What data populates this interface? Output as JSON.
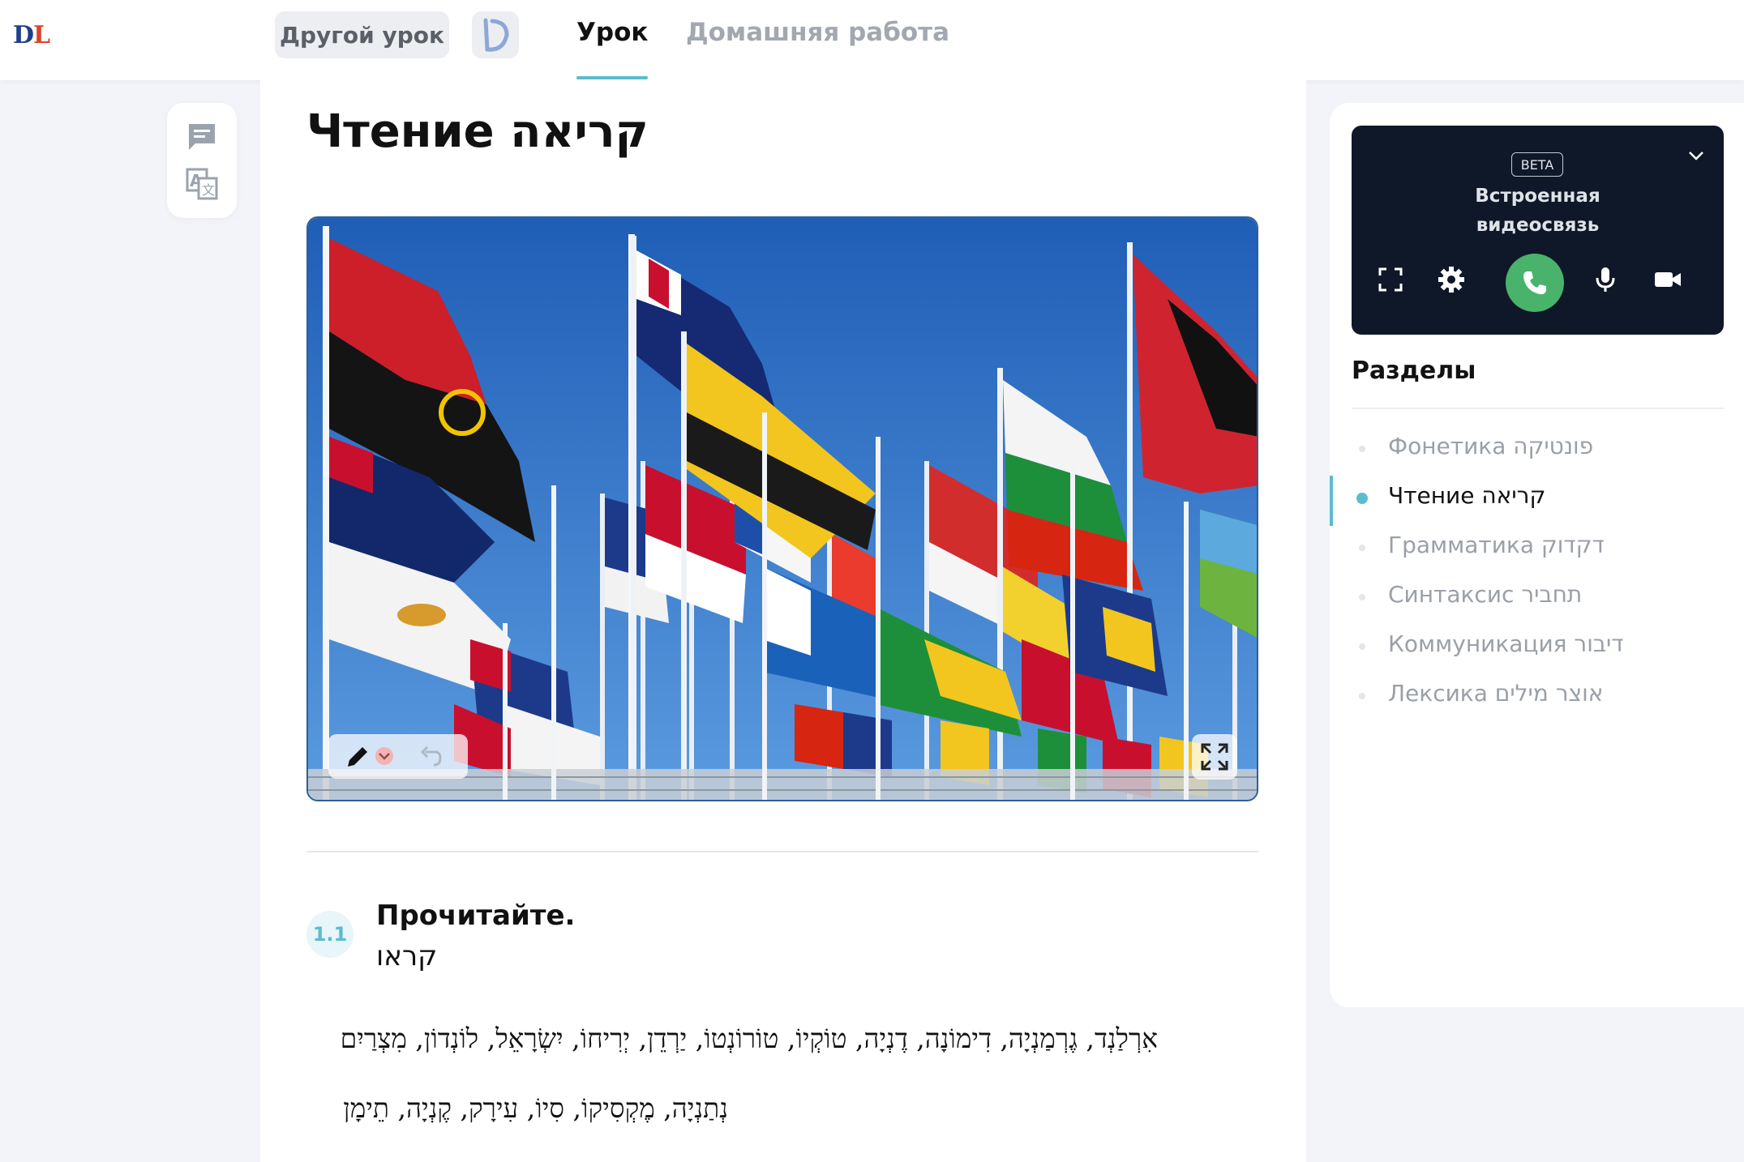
{
  "header": {
    "logo_d": "D",
    "logo_l": "L",
    "other_lesson_label": "Другой урок",
    "tabs": [
      {
        "label": "Урок",
        "active": true
      },
      {
        "label": "Домашняя работа",
        "active": false
      }
    ]
  },
  "left_tools": {
    "icons": [
      "comment-icon",
      "translate-icon"
    ]
  },
  "main": {
    "title": "Чтение קריאה",
    "image": {
      "subject": "flags",
      "toolbar_icons": [
        "pencil-icon",
        "chevron-down-icon",
        "undo-icon"
      ],
      "expand_icon": "expand-icon"
    },
    "exercise": {
      "number": "1.1",
      "title": "Прочитайте.",
      "subtitle": "קראו",
      "lines": [
        "אִרְלַנְד, גֶרְמַנְיָה, דִימוֹנָה, דֶנְיָה, טוֹקְיוֹ, טוֹרוֹנְטוֹ, יַרְדֵן, יְרִיחוֹ, יִשְׂרָאֵל, לוֹנְדוֹן, מִצְרַיִם",
        "נְתַנְיָה, מֶקְסִיקוֹ, סִיוֹ, עִירָק, קֶנְיָה, תֵימָן"
      ]
    }
  },
  "video": {
    "badge": "BETA",
    "title_line1": "Встроенная",
    "title_line2": "видеосвязь",
    "icons": [
      "fullscreen-icon",
      "gear-icon",
      "phone-icon",
      "microphone-icon",
      "camera-icon"
    ],
    "call_color": "#49b36b"
  },
  "sections": {
    "title": "Разделы",
    "items": [
      {
        "label": "Фонетика פונטיקה",
        "active": false
      },
      {
        "label": "Чтение קריאה",
        "active": true
      },
      {
        "label": "Грамматика דקדוק",
        "active": false
      },
      {
        "label": "Синтаксис תחביר",
        "active": false
      },
      {
        "label": "Коммуникация דיבור",
        "active": false
      },
      {
        "label": "Лексика אוצר מילים",
        "active": false
      }
    ]
  },
  "colors": {
    "accent": "#5bbccf",
    "video_bg": "#0f1828"
  }
}
